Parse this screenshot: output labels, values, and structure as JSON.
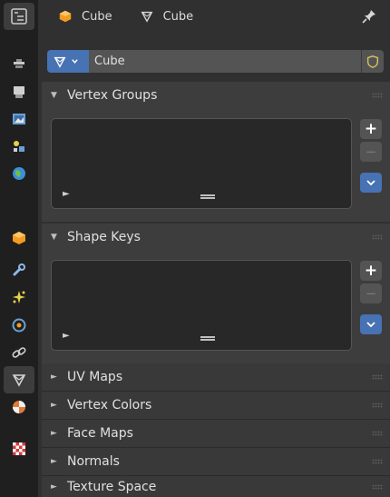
{
  "header": {
    "object_name": "Cube",
    "mesh_name": "Cube"
  },
  "mesh_selector": {
    "value": "Cube"
  },
  "panels": {
    "vertex_groups": {
      "title": "Vertex Groups",
      "arrow": "▼"
    },
    "shape_keys": {
      "title": "Shape Keys",
      "arrow": "▼"
    },
    "uv_maps": {
      "title": "UV Maps",
      "arrow": "►"
    },
    "vertex_colors": {
      "title": "Vertex Colors",
      "arrow": "►"
    },
    "face_maps": {
      "title": "Face Maps",
      "arrow": "►"
    },
    "normals": {
      "title": "Normals",
      "arrow": "►"
    },
    "texture_space": {
      "title": "Texture Space",
      "arrow": "►"
    }
  },
  "list_controls": {
    "add": "+",
    "remove": "−",
    "play": "►"
  },
  "tabs": [
    "tool-icon",
    "render-icon",
    "output-icon",
    "view-layer-icon",
    "scene-icon",
    "world-icon",
    "object-icon",
    "modifier-icon",
    "particles-icon",
    "physics-icon",
    "constraints-icon",
    "mesh-data-icon",
    "material-icon",
    "texture-icon"
  ],
  "colors": {
    "accent": "#4772b3",
    "panel_bg": "#3d3d3d",
    "editor_bg": "#303030",
    "tab_column_bg": "#1f1f1f"
  }
}
